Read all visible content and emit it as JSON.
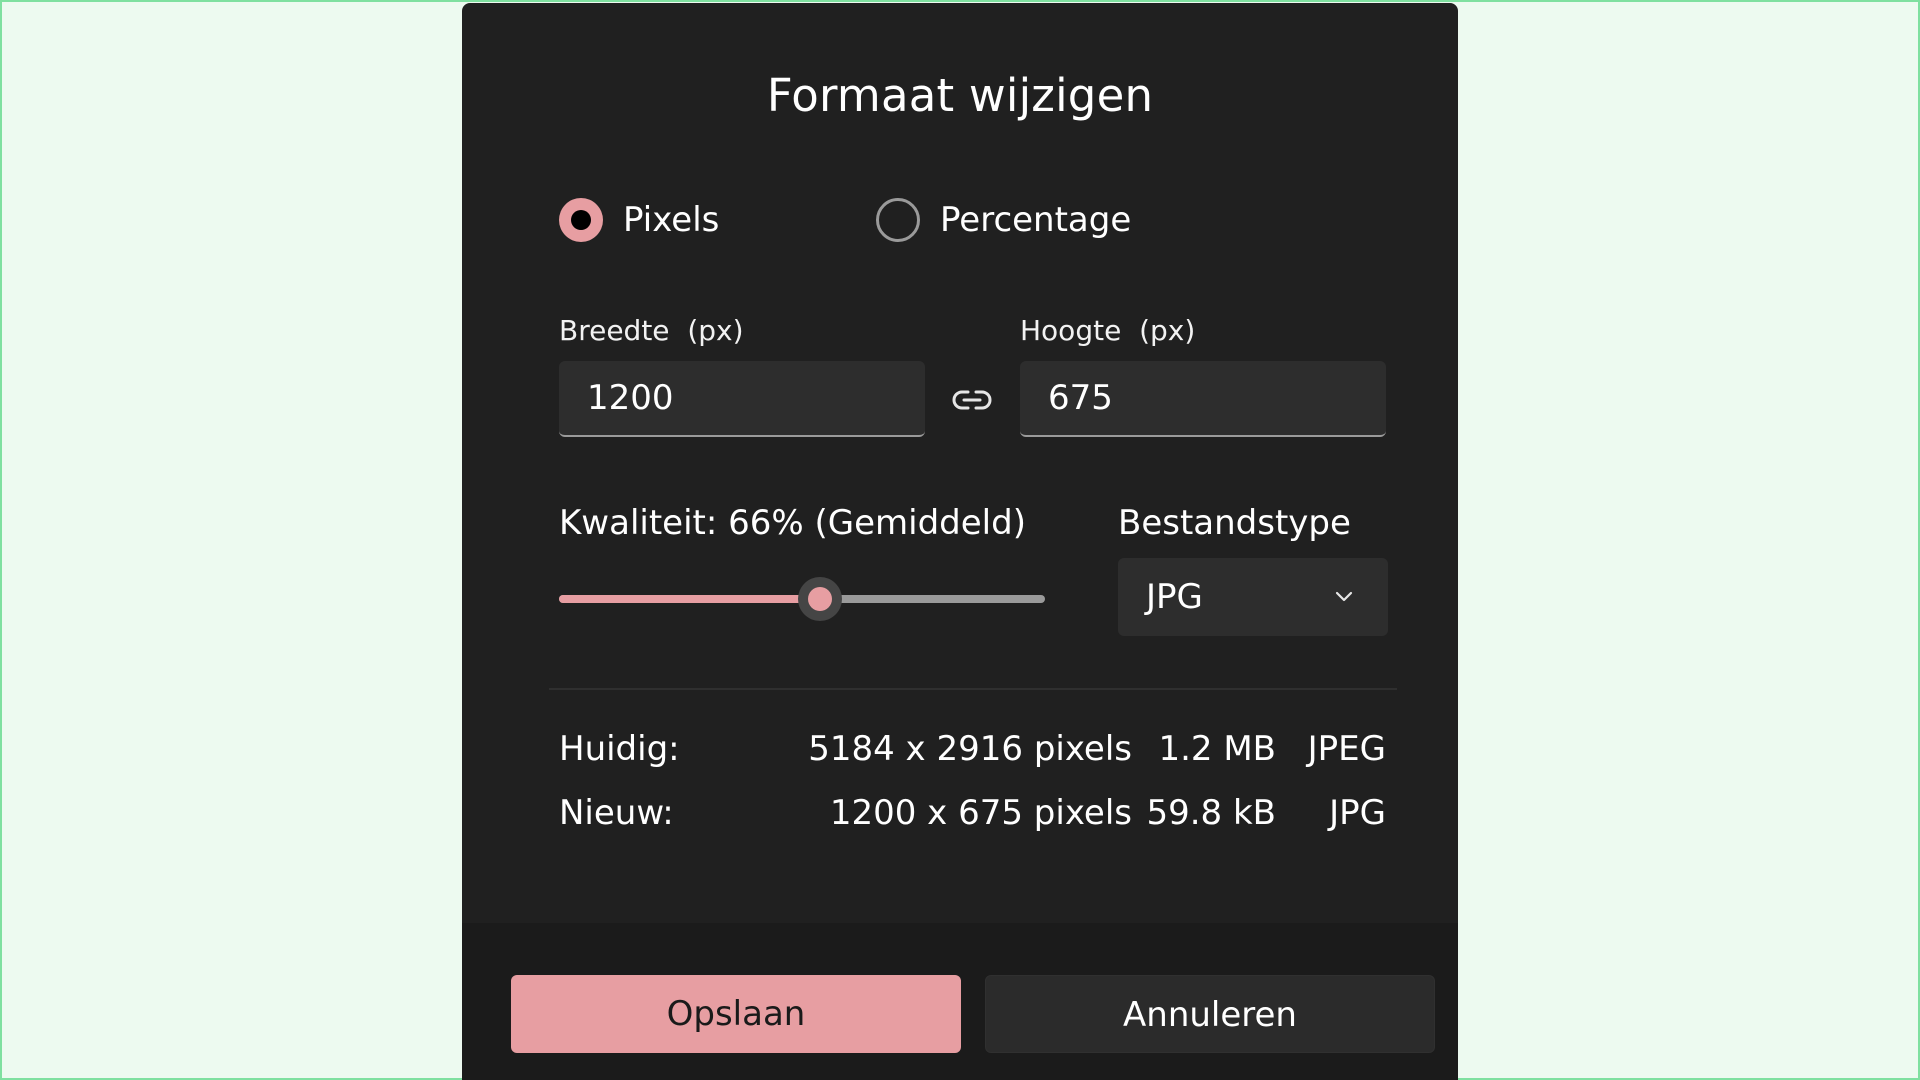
{
  "dialog": {
    "title": "Formaat wijzigen",
    "mode_options": [
      {
        "label": "Pixels",
        "selected": true
      },
      {
        "label": "Percentage",
        "selected": false
      }
    ],
    "width_field": {
      "label": "Breedte  (px)",
      "value": "1200"
    },
    "height_field": {
      "label": "Hoogte  (px)",
      "value": "675"
    },
    "link_icon": "link-chain-icon",
    "quality": {
      "label": "Kwaliteit: 66% (Gemiddeld)",
      "value_percent": 66
    },
    "filetype": {
      "label": "Bestandstype",
      "selected": "JPG",
      "icon": "chevron-down-icon"
    },
    "info": {
      "current": {
        "label": "Huidig:",
        "dimensions": "5184 x 2916 pixels",
        "size": "1.2 MB",
        "type": "JPEG"
      },
      "new": {
        "label": "Nieuw:",
        "dimensions": "1200 x 675 pixels",
        "size": "59.8 kB",
        "type": "JPG"
      }
    },
    "buttons": {
      "save": "Opslaan",
      "cancel": "Annuleren"
    }
  },
  "colors": {
    "accent": "#e79ea2",
    "dialog_background": "#202020",
    "page_background": "#edfaf0"
  }
}
